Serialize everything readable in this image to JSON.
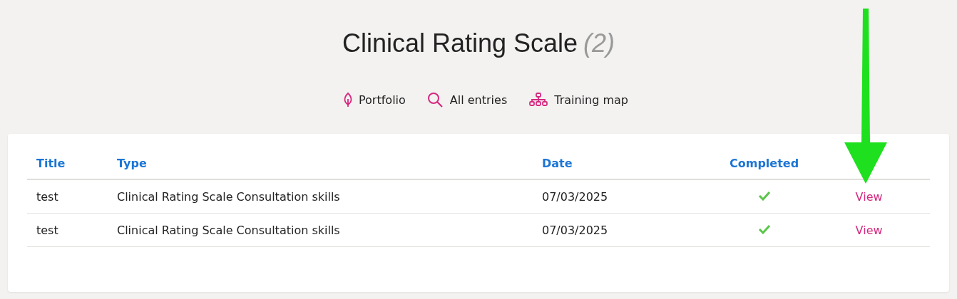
{
  "page": {
    "title": "Clinical Rating Scale",
    "count": "(2)"
  },
  "nav": [
    {
      "kind": "leaf",
      "label": "Portfolio"
    },
    {
      "kind": "search",
      "label": "All entries"
    },
    {
      "kind": "sitemap",
      "label": "Training map"
    }
  ],
  "table": {
    "columns": [
      "Title",
      "Type",
      "Date",
      "Completed"
    ],
    "rows": [
      {
        "title": "test",
        "type": "Clinical Rating Scale Consultation skills",
        "date": "07/03/2025",
        "completed": true,
        "action": "View"
      },
      {
        "title": "test",
        "type": "Clinical Rating Scale Consultation skills",
        "date": "07/03/2025",
        "completed": true,
        "action": "View"
      }
    ]
  }
}
